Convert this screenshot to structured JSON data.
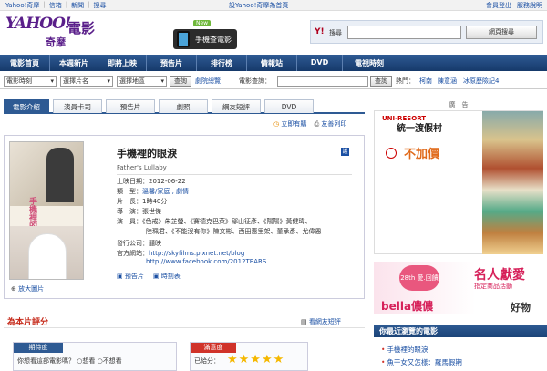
{
  "topbar": {
    "links": [
      "Yahoo!奇摩",
      "信箱",
      "新聞",
      "搜尋"
    ],
    "center": "設Yahoo!奇摩為首頁",
    "right": [
      "會員登出",
      "服務說明"
    ]
  },
  "header": {
    "logo": "YAHOO!",
    "logo_sub": "奇摩",
    "section": "電影",
    "promo_badge": "New",
    "promo_label": "手機查電影",
    "search_brand": "Y!",
    "search_label": "搜尋",
    "search_value": "",
    "search_button": "網頁搜尋"
  },
  "nav": {
    "items": [
      "電影首頁",
      "本週新片",
      "即將上映",
      "預告片",
      "排行榜",
      "情報站",
      "DVD",
      "電視時刻"
    ]
  },
  "filter": {
    "theater_select": "電影時刻",
    "movie_select": "選擇片名",
    "area_select": "選擇地區",
    "query_button": "查詢",
    "advanced_link": "劇院總覽",
    "movie_query_label": "電影查詢：",
    "movie_query_value": "",
    "query_button2": "查詢",
    "hot_label": "熱門：",
    "hot_links": [
      "柯南",
      "陳意涵",
      "冰原歷險記4"
    ]
  },
  "tabs": [
    "電影介紹",
    "演員卡司",
    "預告片",
    "劇照",
    "網友短評",
    "DVD"
  ],
  "actions": {
    "buy_ticket": "立即有購",
    "print": "友善列印"
  },
  "movie": {
    "title": "手機裡的眼淚",
    "english_title": "Father's Lullaby",
    "release": "2012-06-22",
    "genre": "溫馨/家庭 , 劇情",
    "length": "1時40分",
    "director": "張世傑",
    "cast": "《色戒》朱芷瑩、《賽德克巴萊》鄔山征彥、《陽陽》黃健瑋、",
    "cast2": "陸珮君、《不能沒有你》陳文彬、西田惠里架、董承彥、尤偉恩",
    "distributor": "囍映",
    "site1": "http://skyfilms.pixnet.net/blog",
    "site2": "http://www.facebook.com/2012TEARS",
    "trailer_link": "預告片",
    "showtime_link": "時刻表",
    "enlarge": "放大圖片",
    "poster_title": "手機裡的眼淚",
    "labels": {
      "release": "上映日期：",
      "genre": "類　型：",
      "length": "片　長：",
      "director": "導　演：",
      "cast": "演　員：",
      "distributor": "發行公司：",
      "site": "官方網站："
    }
  },
  "rating": {
    "title": "為本片評分",
    "link": "看網友短評",
    "expect_header": "期待度",
    "expect_question": "你想看這部電影嗎？",
    "expect_yes": "想看",
    "expect_no": "不想看",
    "satis_header": "滿意度",
    "satis_label": "已給分：",
    "stars": "★★★★★"
  },
  "right": {
    "ad_label": "廣　告",
    "ad1_brand": "統一渡假村",
    "ad1_brand_small": "UNI-RESORT",
    "ad1_big": "不加價",
    "ad2_badge": "28th 愛.回饋",
    "ad2_t1": "名人獻愛",
    "ad2_t2": "指定商品活動",
    "ad2_brand": "bella儂儂",
    "ad2_tail": "好物",
    "recent_header": "你最近瀏覽的電影",
    "recent": [
      "手機裡的眼淚",
      "魚干女又怎樣：羅馬假期"
    ]
  }
}
